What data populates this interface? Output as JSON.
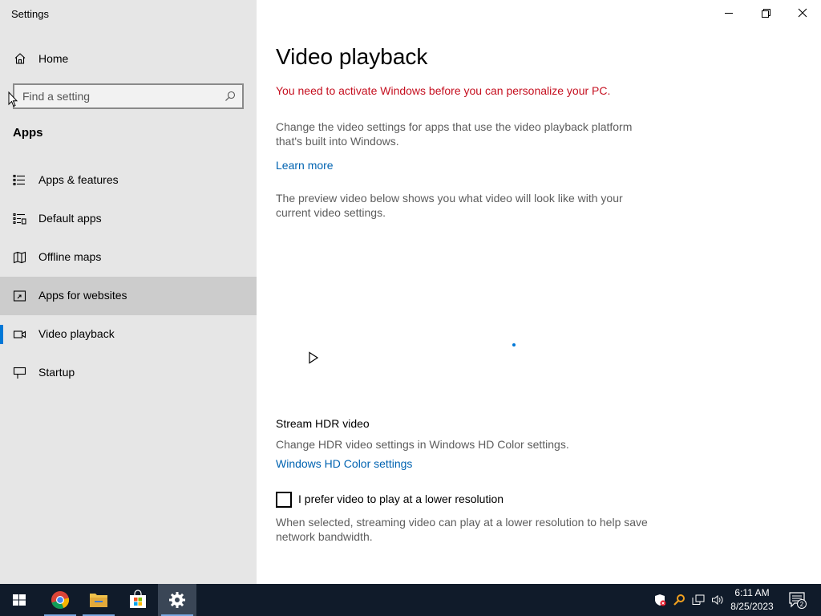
{
  "window": {
    "title": "Settings"
  },
  "sidebar": {
    "home_label": "Home",
    "search_placeholder": "Find a setting",
    "section_title": "Apps",
    "items": [
      {
        "label": "Apps & features",
        "icon": "apps-features-icon"
      },
      {
        "label": "Default apps",
        "icon": "default-apps-icon"
      },
      {
        "label": "Offline maps",
        "icon": "map-icon"
      },
      {
        "label": "Apps for websites",
        "icon": "apps-websites-icon"
      },
      {
        "label": "Video playback",
        "icon": "video-icon",
        "selected": true
      },
      {
        "label": "Startup",
        "icon": "startup-icon"
      }
    ]
  },
  "main": {
    "title": "Video playback",
    "activation_warning": "You need to activate Windows before you can personalize your PC.",
    "description": "Change the video settings for apps that use the video playback platform that's built into Windows.",
    "learn_more": "Learn more",
    "preview_text": "The preview video below shows you what video will look like with your current video settings.",
    "hdr_heading": "Stream HDR video",
    "hdr_text": "Change HDR video settings in Windows HD Color settings.",
    "hdr_link": "Windows HD Color settings",
    "lower_res_label": "I prefer video to play at a lower resolution",
    "lower_res_checked": false,
    "lower_res_help": "When selected, streaming video can play at a lower resolution to help save network bandwidth."
  },
  "taskbar": {
    "apps": [
      "start-icon",
      "chrome-icon",
      "file-explorer-icon",
      "store-icon",
      "settings-icon"
    ],
    "time": "6:11 AM",
    "date": "8/25/2023",
    "notification_count": "2"
  },
  "colors": {
    "accent": "#0078d7",
    "link": "#0063b1",
    "warning": "#c50f1f",
    "sidebar_bg": "#e6e6e6",
    "taskbar_bg": "#101b2a"
  }
}
